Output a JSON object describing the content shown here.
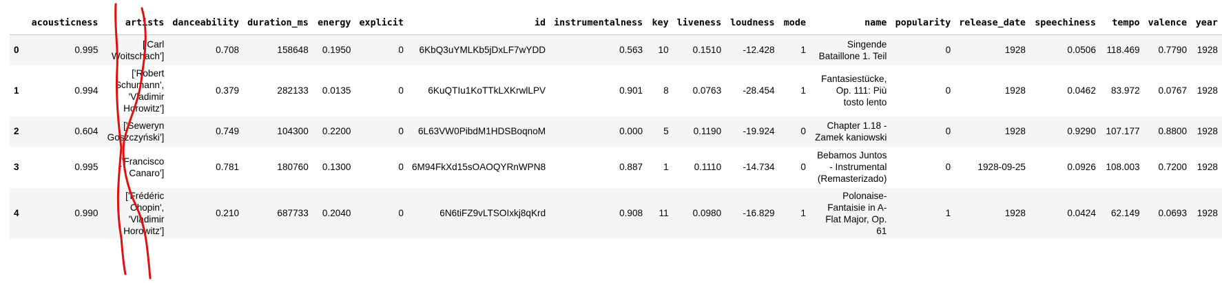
{
  "table": {
    "columns": [
      "",
      "acousticness",
      "artists",
      "danceability",
      "duration_ms",
      "energy",
      "explicit",
      "id",
      "instrumentalness",
      "key",
      "liveness",
      "loudness",
      "mode",
      "name",
      "popularity",
      "release_date",
      "speechiness",
      "tempo",
      "valence",
      "year"
    ],
    "rows": [
      {
        "index": "0",
        "acousticness": "0.995",
        "artists": [
          "['Carl",
          "Woitschach']"
        ],
        "danceability": "0.708",
        "duration_ms": "158648",
        "energy": "0.1950",
        "explicit": "0",
        "id": "6KbQ3uYMLKb5jDxLF7wYDD",
        "instrumentalness": "0.563",
        "key": "10",
        "liveness": "0.1510",
        "loudness": "-12.428",
        "mode": "1",
        "name": [
          "Singende",
          "Bataillone 1. Teil"
        ],
        "popularity": "0",
        "release_date": "1928",
        "speechiness": "0.0506",
        "tempo": "118.469",
        "valence": "0.7790",
        "year": "1928"
      },
      {
        "index": "1",
        "acousticness": "0.994",
        "artists": [
          "['Robert",
          "Schumann',",
          "'Vladimir",
          "Horowitz']"
        ],
        "danceability": "0.379",
        "duration_ms": "282133",
        "energy": "0.0135",
        "explicit": "0",
        "id": "6KuQTIu1KoTTkLXKrwlLPV",
        "instrumentalness": "0.901",
        "key": "8",
        "liveness": "0.0763",
        "loudness": "-28.454",
        "mode": "1",
        "name": [
          "Fantasiestücke,",
          "Op. 111: Più",
          "tosto lento"
        ],
        "popularity": "0",
        "release_date": "1928",
        "speechiness": "0.0462",
        "tempo": "83.972",
        "valence": "0.0767",
        "year": "1928"
      },
      {
        "index": "2",
        "acousticness": "0.604",
        "artists": [
          "['Seweryn",
          "Goszczyński']"
        ],
        "danceability": "0.749",
        "duration_ms": "104300",
        "energy": "0.2200",
        "explicit": "0",
        "id": "6L63VW0PibdM1HDSBoqnoM",
        "instrumentalness": "0.000",
        "key": "5",
        "liveness": "0.1190",
        "loudness": "-19.924",
        "mode": "0",
        "name": [
          "Chapter 1.18 -",
          "Zamek kaniowski"
        ],
        "popularity": "0",
        "release_date": "1928",
        "speechiness": "0.9290",
        "tempo": "107.177",
        "valence": "0.8800",
        "year": "1928"
      },
      {
        "index": "3",
        "acousticness": "0.995",
        "artists": [
          "['Francisco",
          "Canaro']"
        ],
        "danceability": "0.781",
        "duration_ms": "180760",
        "energy": "0.1300",
        "explicit": "0",
        "id": "6M94FkXd15sOAOQYRnWPN8",
        "instrumentalness": "0.887",
        "key": "1",
        "liveness": "0.1110",
        "loudness": "-14.734",
        "mode": "0",
        "name": [
          "Bebamos Juntos",
          "- Instrumental",
          "(Remasterizado)"
        ],
        "popularity": "0",
        "release_date": "1928-09-25",
        "speechiness": "0.0926",
        "tempo": "108.003",
        "valence": "0.7200",
        "year": "1928"
      },
      {
        "index": "4",
        "acousticness": "0.990",
        "artists": [
          "['Frédéric",
          "Chopin',",
          "'Vladimir",
          "Horowitz']"
        ],
        "danceability": "0.210",
        "duration_ms": "687733",
        "energy": "0.2040",
        "explicit": "0",
        "id": "6N6tiFZ9vLTSOIxkj8qKrd",
        "instrumentalness": "0.908",
        "key": "11",
        "liveness": "0.0980",
        "loudness": "-16.829",
        "mode": "1",
        "name": [
          "Polonaise-",
          "Fantaisie in A-",
          "Flat Major, Op.",
          "61"
        ],
        "popularity": "1",
        "release_date": "1928",
        "speechiness": "0.0424",
        "tempo": "62.149",
        "valence": "0.0693",
        "year": "1928"
      }
    ]
  },
  "annotation": {
    "stroke_color": "#e01010"
  },
  "colors": {
    "row_odd": "#f5f5f5",
    "row_even": "#ffffff",
    "header_rule": "#c8c8c8"
  }
}
